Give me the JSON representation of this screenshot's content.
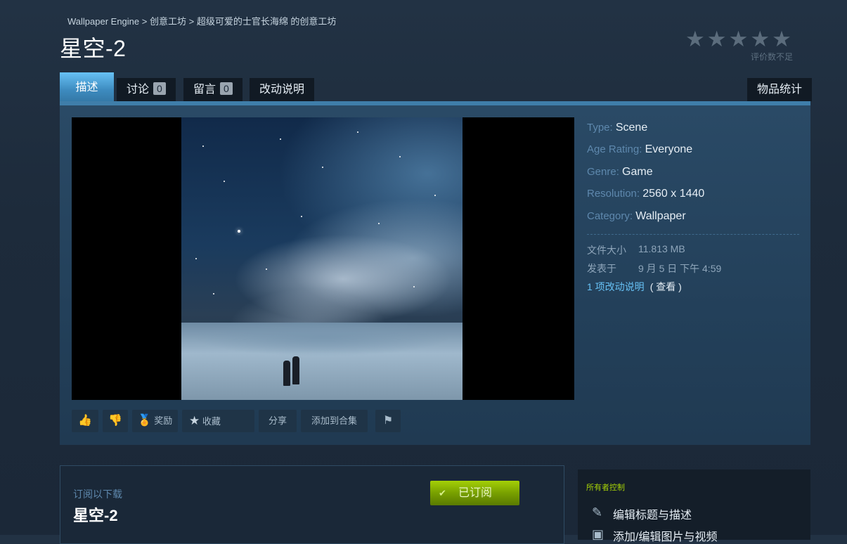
{
  "breadcrumb": {
    "app": "Wallpaper Engine",
    "sep1": " > ",
    "workshop": "创意工坊",
    "sep2": " > ",
    "owner_workshop": "超级可爱的士官长海绵 的创意工坊"
  },
  "item": {
    "title": "星空-2"
  },
  "rating": {
    "stars": "★★★★★",
    "note": "评价数不足"
  },
  "tabs": {
    "description": "描述",
    "discussion": "讨论",
    "discussion_count": "0",
    "comments": "留言",
    "comments_count": "0",
    "changelog": "改动说明",
    "stats": "物品统计"
  },
  "meta": {
    "type_label": "Type:",
    "type_value": "Scene",
    "age_label": "Age Rating:",
    "age_value": "Everyone",
    "genre_label": "Genre:",
    "genre_value": "Game",
    "res_label": "Resolution:",
    "res_value": "2560 x 1440",
    "cat_label": "Category:",
    "cat_value": "Wallpaper"
  },
  "details": {
    "size_label": "文件大小",
    "size_value": "11.813 MB",
    "posted_label": "发表于",
    "posted_value": "9 月 5 日 下午 4:59",
    "changes_link": "1 项改动说明",
    "changes_view": "( 查看 )"
  },
  "actions": {
    "thumbs_up": "👍",
    "thumbs_down": "👎",
    "award_label": "奖励",
    "favorite_label": "收藏",
    "share_label": "分享",
    "collection_label": "添加到合集",
    "flag": "⚑"
  },
  "subscribe": {
    "label": "订阅以下载",
    "title": "星空-2",
    "button": "已订阅",
    "check": "✔"
  },
  "owner": {
    "title": "所有者控制",
    "edit_title": "编辑标题与描述",
    "edit_images": "添加/编辑图片与视频"
  }
}
